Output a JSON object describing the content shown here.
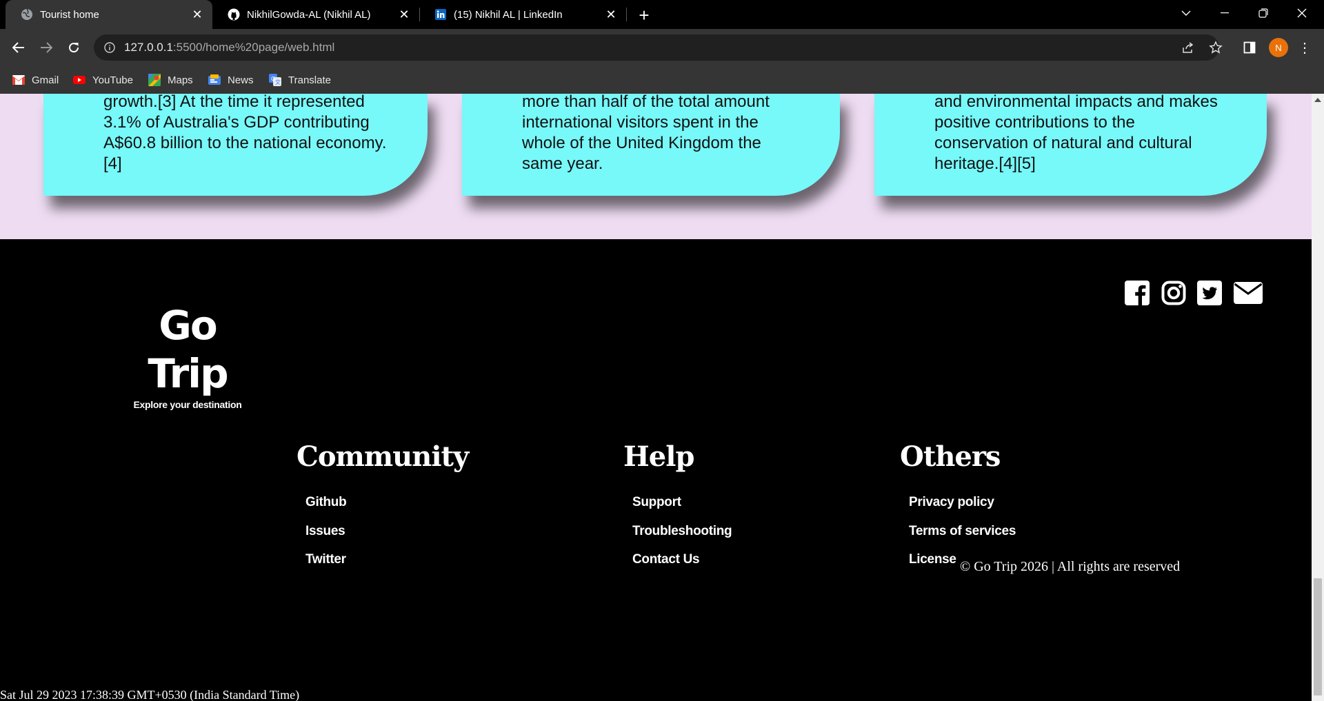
{
  "browser": {
    "tabs": [
      {
        "title": "Tourist home",
        "icon": "globe-icon",
        "active": true
      },
      {
        "title": "NikhilGowda-AL (Nikhil AL)",
        "icon": "github-icon",
        "active": false
      },
      {
        "title": "(15) Nikhil AL | LinkedIn",
        "icon": "linkedin-icon",
        "active": false
      }
    ],
    "new_tab_label": "+",
    "url_host": "127.0.0.1",
    "url_rest": ":5500/home%20page/web.html",
    "profile_initial": "N",
    "bookmarks": [
      {
        "label": "Gmail",
        "icon": "gmail-icon"
      },
      {
        "label": "YouTube",
        "icon": "youtube-icon"
      },
      {
        "label": "Maps",
        "icon": "maps-icon"
      },
      {
        "label": "News",
        "icon": "news-icon"
      },
      {
        "label": "Translate",
        "icon": "translate-icon"
      }
    ]
  },
  "cards": [
    {
      "lines": [
        "growth.[3] At the time it represented",
        "3.1% of Australia's GDP contributing",
        "A$60.8 billion to the national economy.",
        "[4]"
      ]
    },
    {
      "lines": [
        "more than half of the total amount",
        "international visitors spent in the",
        "whole of the United Kingdom the",
        "same year."
      ]
    },
    {
      "lines": [
        "and environmental impacts and makes",
        "positive contributions to the",
        "conservation of natural and cultural",
        "heritage.[4][5]"
      ]
    }
  ],
  "footer": {
    "brand": "Go Trip",
    "tagline": "Explore your destination",
    "social": [
      "facebook-icon",
      "instagram-icon",
      "twitter-icon",
      "envelope-icon"
    ],
    "columns": [
      {
        "title": "Community",
        "links": [
          "Github",
          "Issues",
          "Twitter"
        ]
      },
      {
        "title": "Help",
        "links": [
          "Support",
          "Troubleshooting",
          "Contact Us"
        ]
      },
      {
        "title": "Others",
        "links": [
          "Privacy policy",
          "Terms of services",
          "License"
        ]
      }
    ],
    "copyright": "© Go Trip 2026 | All rights are reserved",
    "datestamp": "Sat Jul 29 2023 17:38:39 GMT+0530 (India Standard Time)"
  },
  "colors": {
    "card_bg": "#77f8f9",
    "section_bg": "#eedcf3",
    "footer_bg": "#000000",
    "profile_bg": "#e8710a"
  }
}
